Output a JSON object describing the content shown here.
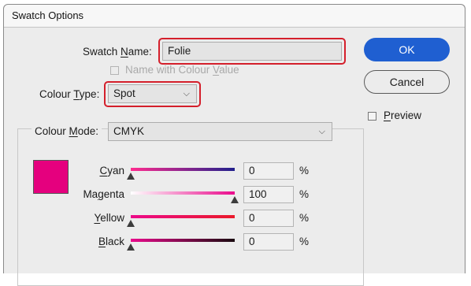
{
  "window": {
    "title": "Swatch Options"
  },
  "swatch_name": {
    "label_pre": "Swatch ",
    "label_key": "N",
    "label_post": "ame:",
    "value": "Folie"
  },
  "name_with_colour_value": {
    "label_pre": "Name with Colour ",
    "label_key": "V",
    "label_post": "alue",
    "checked": false,
    "enabled": false
  },
  "colour_type": {
    "label_pre": "Colour ",
    "label_key": "T",
    "label_post": "ype:",
    "value": "Spot"
  },
  "colour_mode": {
    "label_pre": "Colour ",
    "label_key": "M",
    "label_post": "ode:",
    "value": "CMYK"
  },
  "buttons": {
    "ok": "OK",
    "cancel": "Cancel"
  },
  "preview": {
    "label_key": "P",
    "label_post": "review",
    "checked": false
  },
  "swatch_color": "#e5007e",
  "channels": [
    {
      "key": "C",
      "rest": "yan",
      "pre": "",
      "value": "0",
      "unit": "%",
      "fraction": 0.0,
      "gradient": [
        "#ff2b8f",
        "#21208c"
      ]
    },
    {
      "key": "g",
      "rest": "enta",
      "pre": "Ma",
      "value": "100",
      "unit": "%",
      "fraction": 1.0,
      "gradient": [
        "#ffffff",
        "#ea0a8c"
      ]
    },
    {
      "key": "Y",
      "rest": "ellow",
      "pre": "",
      "value": "0",
      "unit": "%",
      "fraction": 0.0,
      "gradient": [
        "#ec0a8a",
        "#ea1a2a"
      ]
    },
    {
      "key": "B",
      "rest": "lack",
      "pre": "",
      "value": "0",
      "unit": "%",
      "fraction": 0.0,
      "gradient": [
        "#ea0a8c",
        "#1a0a10"
      ]
    }
  ],
  "highlight_color": "#d41f2b",
  "accent_color": "#1f5fd1"
}
